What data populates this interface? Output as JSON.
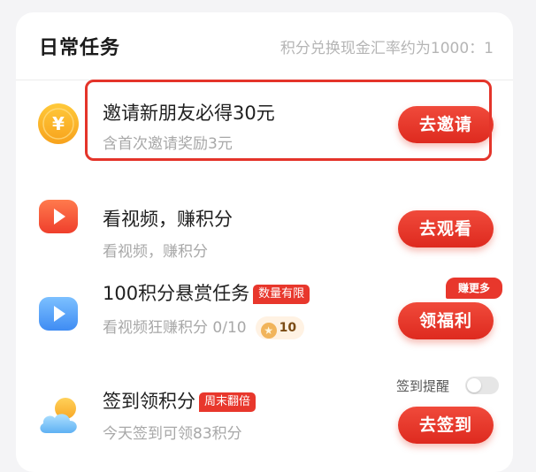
{
  "header": {
    "title": "日常任务",
    "rate_text": "积分兑换现金汇率约为1000：1"
  },
  "tasks": [
    {
      "icon": "yuan-coin-icon",
      "title": "邀请新朋友必得30元",
      "subtitle": "含首次邀请奖励3元",
      "button": "去邀请",
      "highlighted": true
    },
    {
      "icon": "video-play-icon",
      "title": "看视频，赚积分",
      "subtitle": "看视频，赚积分",
      "button": "去观看"
    },
    {
      "icon": "video-play-blue-icon",
      "title": "100积分悬赏任务",
      "tag": "数量有限",
      "subtitle": "看视频狂赚积分 0/10",
      "reward": "10",
      "badge": "赚更多",
      "button": "领福利"
    },
    {
      "icon": "weather-cloud-icon",
      "title": "签到领积分",
      "tag": "周末翻倍",
      "subtitle": "今天签到可领83积分",
      "remind_label": "签到提醒",
      "remind_on": false,
      "button": "去签到"
    }
  ],
  "colors": {
    "accent": "#e8372c",
    "button_gradient_top": "#f04a3b",
    "button_gradient_bottom": "#de2a1f"
  }
}
